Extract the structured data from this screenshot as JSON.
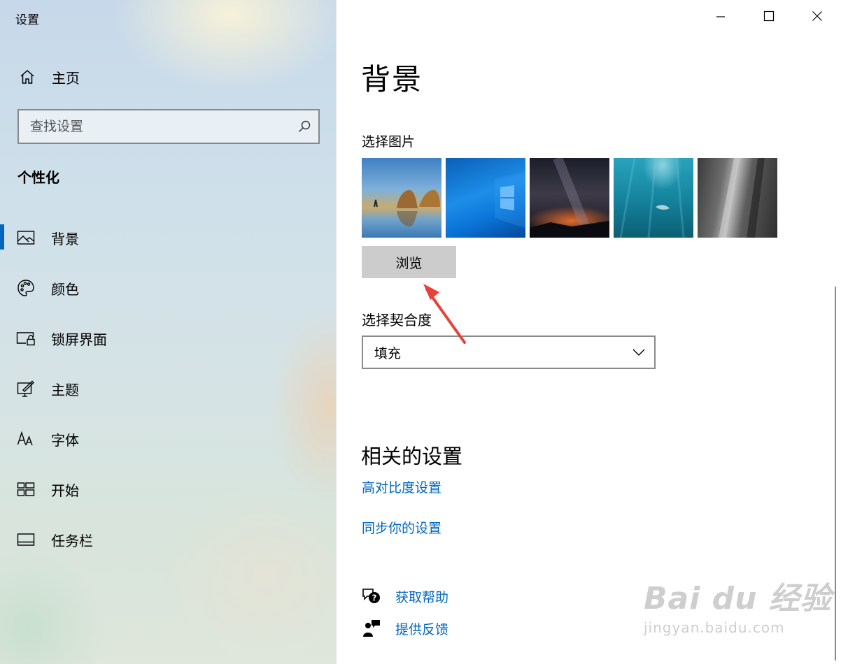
{
  "window": {
    "title": "设置"
  },
  "sidebar": {
    "home_label": "主页",
    "search": {
      "placeholder": "查找设置",
      "value": ""
    },
    "section_title": "个性化",
    "items": [
      {
        "label": "背景",
        "icon": "picture-icon",
        "active": true
      },
      {
        "label": "颜色",
        "icon": "palette-icon",
        "active": false
      },
      {
        "label": "锁屏界面",
        "icon": "lock-screen-icon",
        "active": false
      },
      {
        "label": "主题",
        "icon": "theme-brush-icon",
        "active": false
      },
      {
        "label": "字体",
        "icon": "font-icon",
        "active": false
      },
      {
        "label": "开始",
        "icon": "start-tiles-icon",
        "active": false
      },
      {
        "label": "任务栏",
        "icon": "taskbar-icon",
        "active": false
      }
    ]
  },
  "main": {
    "page_title": "背景",
    "choose_picture_label": "选择图片",
    "browse_label": "浏览",
    "choose_fit_label": "选择契合度",
    "fit_value": "填充",
    "related_title": "相关的设置",
    "links": [
      "高对比度设置",
      "同步你的设置"
    ],
    "help_label": "获取帮助",
    "feedback_label": "提供反馈"
  },
  "colors": {
    "accent": "#0067c0",
    "annotation_arrow": "#e8403a"
  },
  "watermark": {
    "main": "Bai du 经验",
    "sub": "jingyan.baidu.com"
  }
}
